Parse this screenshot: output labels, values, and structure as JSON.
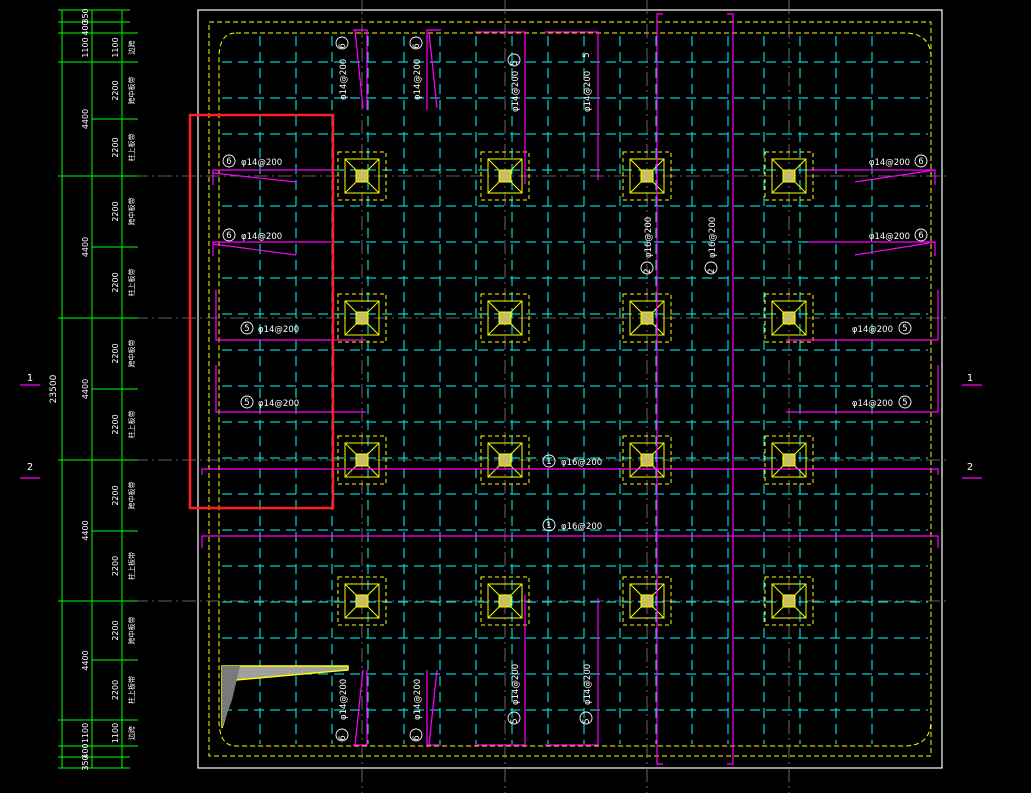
{
  "colors": {
    "background": "#000000",
    "border": "#ffffff",
    "dim": "#00ff00",
    "grid_axis": "#808080",
    "slab_grid": "#00ffff",
    "column": "#ffff00",
    "rebar": "#ff00ff",
    "highlight": "#ff2020",
    "text": "#ffffff"
  },
  "dimensions": {
    "total": "23500",
    "top_pair": [
      "350",
      "400"
    ],
    "bottom_pair": [
      "400",
      "350"
    ],
    "segments": [
      "1100",
      "4400",
      "4400",
      "4400",
      "4400",
      "4400",
      "1100"
    ],
    "inner": [
      "1100",
      "2200",
      "2200",
      "2200",
      "2200",
      "2200",
      "2200",
      "2200",
      "2200",
      "2200",
      "2200",
      "1100"
    ],
    "inner_labels": [
      "边跨",
      "跨中板带",
      "柱上板带",
      "跨中板带",
      "柱上板带",
      "跨中板带",
      "柱上板带",
      "跨中板带",
      "柱上板带",
      "跨中板带",
      "柱上板带",
      "边跨"
    ]
  },
  "section_marks": {
    "left": [
      "1",
      "2"
    ],
    "right": [
      "1",
      "2"
    ]
  },
  "rebar_labels": {
    "left_6a": {
      "num": "6",
      "spec": "φ14@200"
    },
    "left_6b": {
      "num": "6",
      "spec": "φ14@200"
    },
    "left_5a": {
      "num": "5",
      "spec": "φ14@200"
    },
    "left_5b": {
      "num": "5",
      "spec": "φ14@200"
    },
    "right_6a": {
      "num": "6",
      "spec": "φ14@200"
    },
    "right_6b": {
      "num": "6",
      "spec": "φ14@200"
    },
    "right_5a": {
      "num": "5",
      "spec": "φ14@200"
    },
    "right_5b": {
      "num": "5",
      "spec": "φ14@200"
    },
    "mid_1a": {
      "num": "1",
      "spec": "φ16@200"
    },
    "mid_1b": {
      "num": "1",
      "spec": "φ16@200"
    },
    "vert_2a": {
      "num": "2",
      "spec": "φ16@200"
    },
    "vert_2b": {
      "num": "2",
      "spec": "φ16@200"
    },
    "top_6a": {
      "num": "6",
      "spec": "φ14@200"
    },
    "top_6b": {
      "num": "6",
      "spec": "φ14@200"
    },
    "top_5a": {
      "num": "5",
      "spec": "φ14@200"
    },
    "top_5b": {
      "num": "5",
      "spec": "φ14@200"
    },
    "bot_6a": {
      "num": "6",
      "spec": "φ14@200"
    },
    "bot_6b": {
      "num": "6",
      "spec": "φ14@200"
    },
    "bot_5a": {
      "num": "5",
      "spec": "φ14@200"
    },
    "bot_5b": {
      "num": "5",
      "spec": "φ14@200"
    }
  }
}
